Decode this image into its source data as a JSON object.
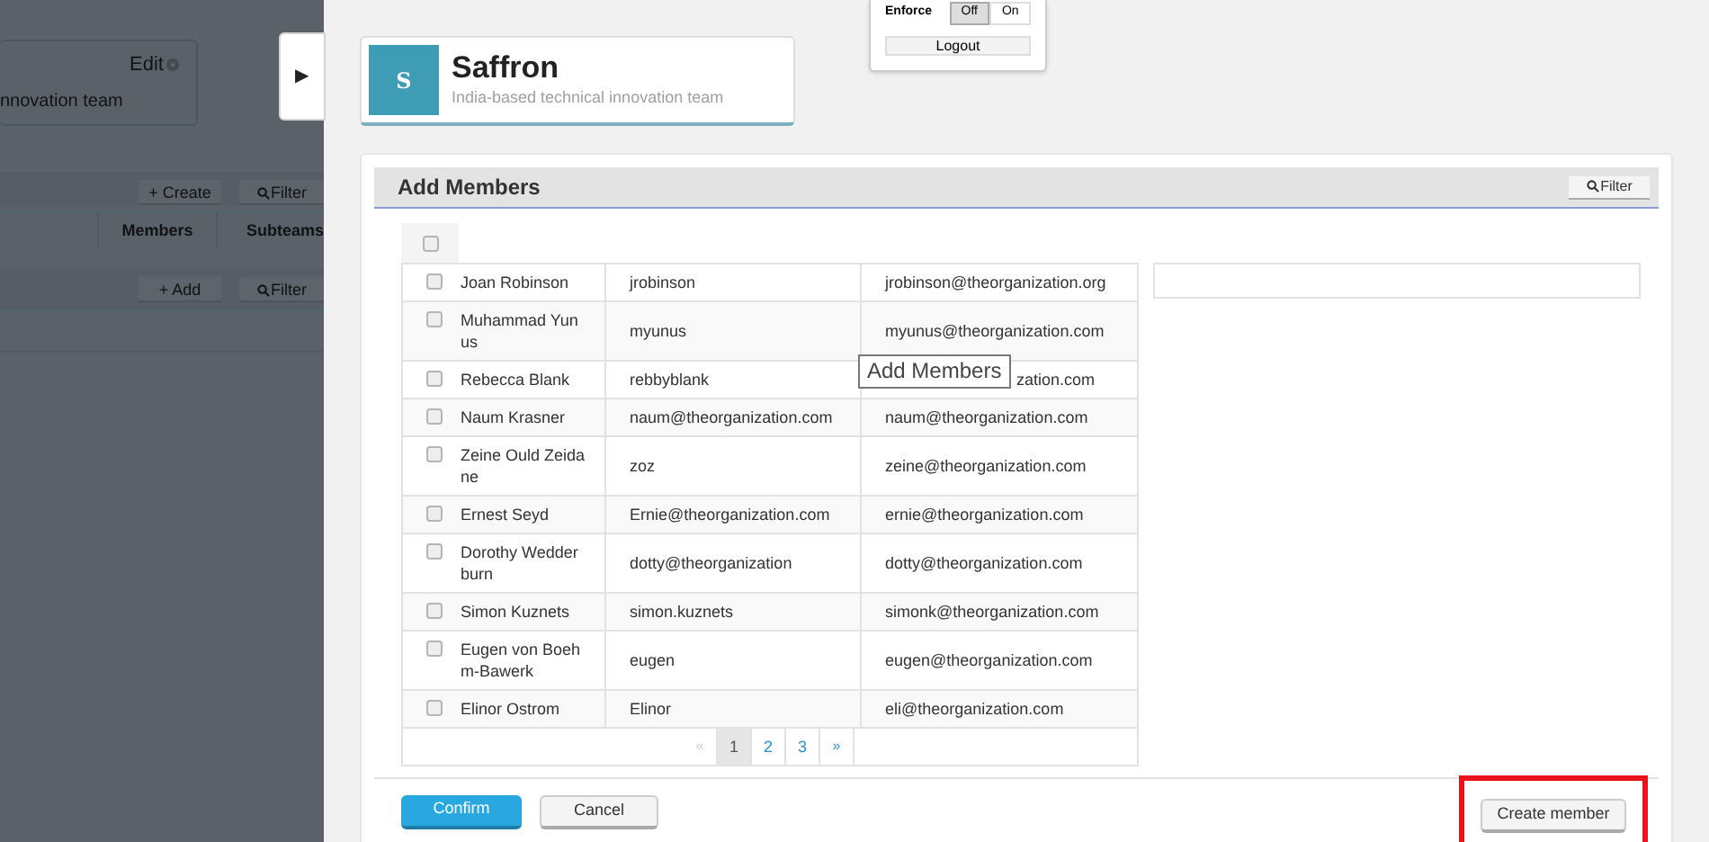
{
  "background_page": {
    "card_action": "Edit",
    "card_subtitle": "nnovation team",
    "toolbar_1": [
      "+ Create",
      "Filter"
    ],
    "columns": [
      "Members",
      "Subteams"
    ],
    "toolbar_2": [
      "+ Add",
      "Filter"
    ]
  },
  "sidebar_toggle": {
    "glyph": "▶"
  },
  "team": {
    "initial": "S",
    "name": "Saffron",
    "description": "India-based technical innovation team"
  },
  "enforce": {
    "label": "Enforce",
    "options": [
      {
        "label": "Off",
        "selected": true
      },
      {
        "label": "On",
        "selected": false
      }
    ],
    "logout": "Logout"
  },
  "panel": {
    "title": "Add Members",
    "filter": "Filter",
    "select_all_checked": false,
    "rows": [
      {
        "name": "Joan Robinson",
        "username": "jrobinson",
        "email": "jrobinson@theorganization.org",
        "checked": false
      },
      {
        "name": "Muhammad Yunus",
        "username": "myunus",
        "email": "myunus@theorganization.com",
        "checked": false
      },
      {
        "name": "Rebecca Blank",
        "username": "rebbyblank",
        "email": "zation.com",
        "checked": false
      },
      {
        "name": "Naum Krasner",
        "username": "naum@theorganization.com",
        "email": "naum@theorganization.com",
        "checked": false
      },
      {
        "name": "Zeine Ould Zeidane",
        "username": "zoz",
        "email": "zeine@theorganization.com",
        "checked": false
      },
      {
        "name": "Ernest Seyd",
        "username": "Ernie@theorganization.com",
        "email": "ernie@theorganization.com",
        "checked": false
      },
      {
        "name": "Dorothy Wedderburn",
        "username": "dotty@theorganization",
        "email": "dotty@theorganization.com",
        "checked": false
      },
      {
        "name": "Simon Kuznets",
        "username": "simon.kuznets",
        "email": "simonk@theorganization.com",
        "checked": false
      },
      {
        "name": "Eugen von Boehm-Bawerk",
        "username": "eugen",
        "email": "eugen@theorganization.com",
        "checked": false
      },
      {
        "name": "Elinor Ostrom",
        "username": "Elinor",
        "email": "eli@theorganization.com",
        "checked": false
      }
    ],
    "pagination": [
      {
        "label": "«",
        "kind": "prev",
        "disabled": true,
        "selected": false
      },
      {
        "label": "1",
        "kind": "page",
        "disabled": false,
        "selected": true
      },
      {
        "label": "2",
        "kind": "page",
        "disabled": false,
        "selected": false
      },
      {
        "label": "3",
        "kind": "page",
        "disabled": false,
        "selected": false
      },
      {
        "label": "»",
        "kind": "next",
        "disabled": false,
        "selected": false
      }
    ],
    "tooltip": "Add Members",
    "confirm": "Confirm",
    "cancel": "Cancel",
    "create_member": "Create member",
    "create_member_highlighted": true
  }
}
